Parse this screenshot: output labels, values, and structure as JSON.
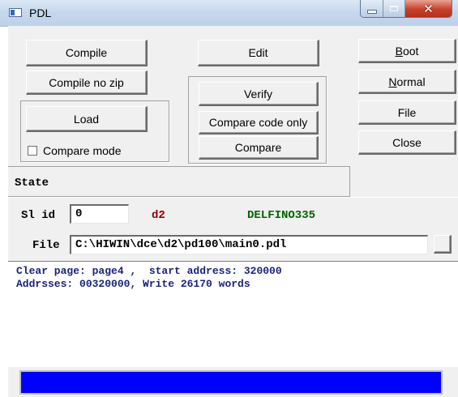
{
  "window": {
    "title": "PDL"
  },
  "buttons": {
    "compile": "Compile",
    "compile_no_zip": "Compile no zip",
    "load": "Load",
    "edit": "Edit",
    "verify": "Verify",
    "compare_code_only": "Compare code only",
    "compare": "Compare",
    "boot_first": "B",
    "boot_rest": "oot",
    "normal_first": "N",
    "normal_rest": "ormal",
    "file": "File",
    "close": "Close",
    "browse": ""
  },
  "compare_mode": {
    "label": "Compare mode",
    "checked": false
  },
  "state": {
    "label": "State"
  },
  "sl_id": {
    "label": "Sl id",
    "value": "0",
    "tag": "d2",
    "device": "DELFINO335",
    "tag_color": "#8b0000",
    "device_color": "#006400"
  },
  "file": {
    "label": "File",
    "path": "C:\\HIWIN\\dce\\d2\\pd100\\main0.pdl"
  },
  "log": {
    "lines": [
      "Clear page: page4 ,  start address: 320000",
      "Addrsses: 00320000, Write 26170 words"
    ]
  },
  "progress": {
    "fraction": 1.0,
    "color": "#0000ff"
  }
}
